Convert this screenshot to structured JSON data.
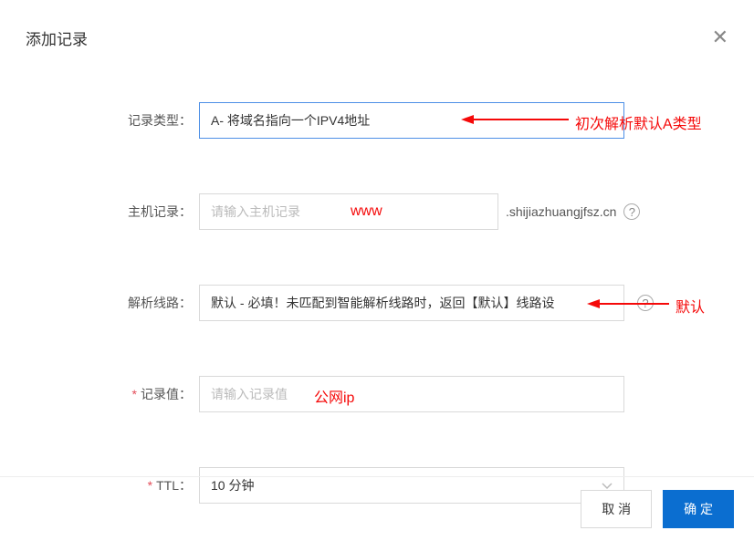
{
  "header": {
    "title": "添加记录"
  },
  "fields": {
    "record_type": {
      "label": "记录类型：",
      "value": "A- 将域名指向一个IPV4地址"
    },
    "host_record": {
      "label": "主机记录：",
      "placeholder": "请输入主机记录",
      "suffix": ".shijiazhuangjfsz.cn"
    },
    "route": {
      "label": "解析线路：",
      "value": "默认 - 必填！未匹配到智能解析线路时，返回【默认】线路设"
    },
    "record_value": {
      "label": "记录值：",
      "placeholder": "请输入记录值"
    },
    "ttl": {
      "label": "TTL：",
      "value": "10 分钟"
    }
  },
  "annotations": {
    "type_note": "初次解析默认A类型",
    "host_note": "www",
    "route_note": "默认",
    "value_note": "公网ip"
  },
  "footer": {
    "cancel": "取 消",
    "confirm": "确 定"
  }
}
